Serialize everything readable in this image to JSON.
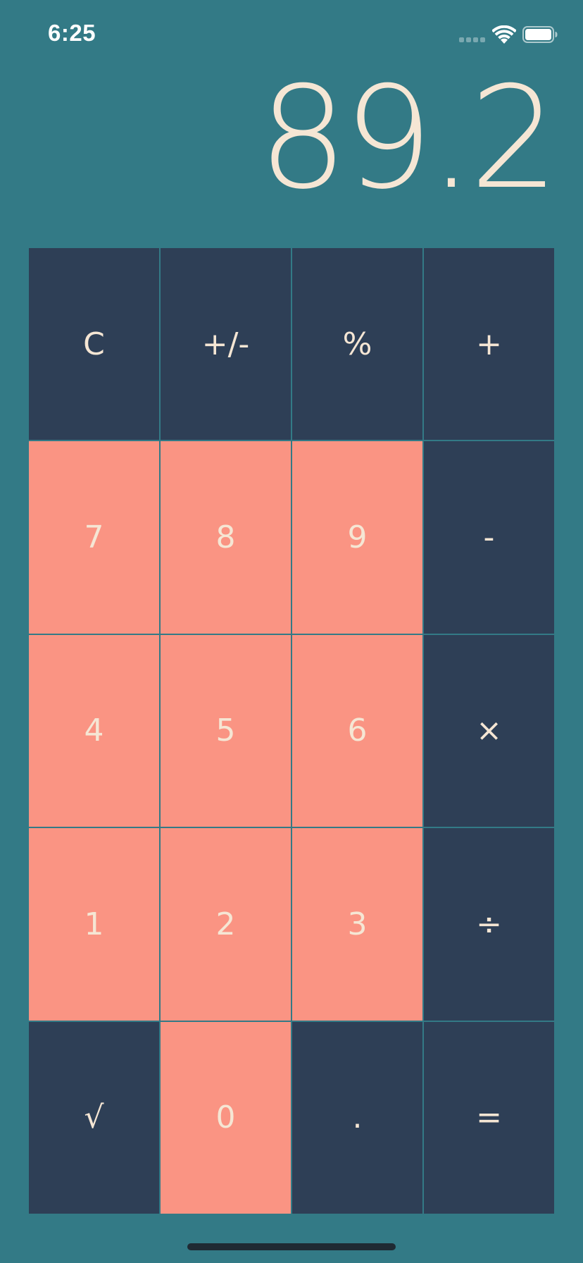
{
  "status_bar": {
    "time": "6:25"
  },
  "display": {
    "value": "89.2"
  },
  "colors": {
    "background": "#337a86",
    "operator_key": "#2e3f56",
    "digit_key": "#fa9483",
    "key_text": "#f5e6d4"
  },
  "keys": {
    "clear": "C",
    "sign": "+/-",
    "percent": "%",
    "add": "+",
    "seven": "7",
    "eight": "8",
    "nine": "9",
    "subtract": "-",
    "four": "4",
    "five": "5",
    "six": "6",
    "multiply": "×",
    "one": "1",
    "two": "2",
    "three": "3",
    "divide": "÷",
    "sqrt": "√",
    "zero": "0",
    "decimal": ".",
    "equals": "="
  }
}
